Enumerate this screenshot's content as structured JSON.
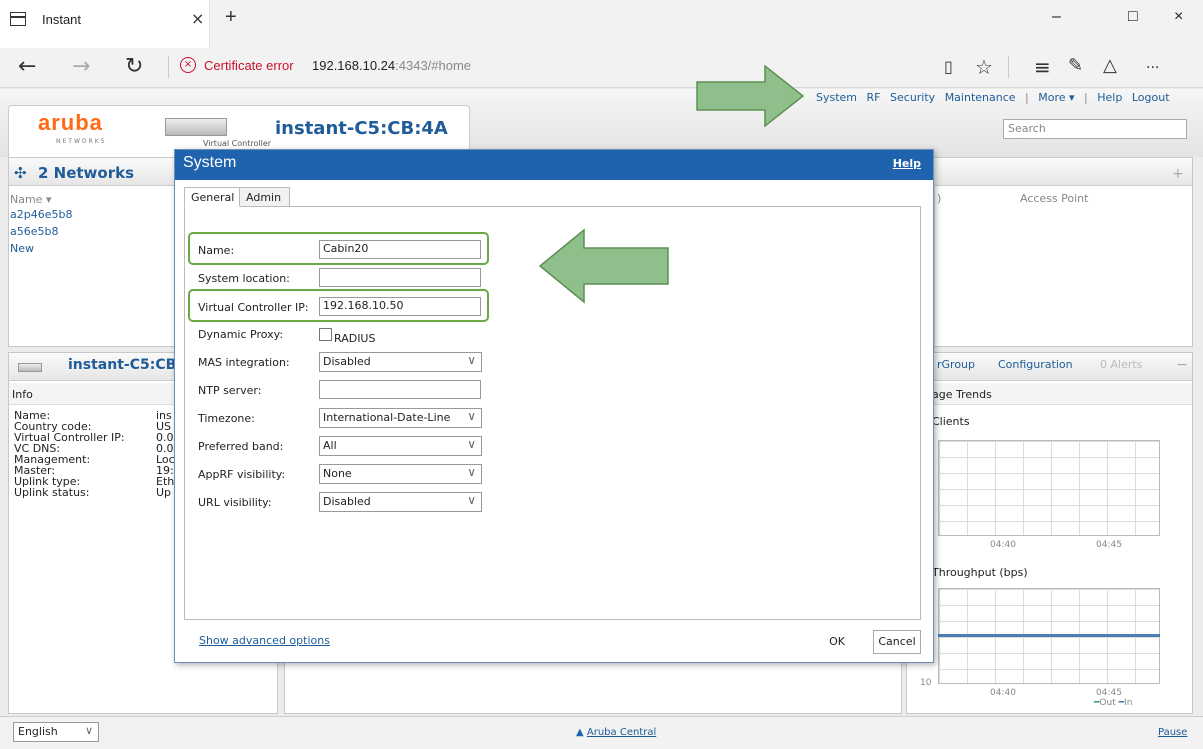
{
  "browser": {
    "tab_title": "Instant",
    "tab_close": "×",
    "new_tab": "+",
    "win_min": "–",
    "win_max": "□",
    "win_close": "×",
    "back": "←",
    "forward": "→",
    "refresh": "↻",
    "cert_error": "Certificate error",
    "url_main": "192.168.10.24",
    "url_rest": ":4343/#home",
    "more": "···"
  },
  "header": {
    "logo": "aruba",
    "logo_sub": "NETWORKS",
    "vc_label": "Virtual Controller",
    "vc_name": "instant-C5:CB:4A",
    "nav": [
      "System",
      "RF",
      "Security",
      "Maintenance",
      "|",
      "More ▾",
      "|",
      "Help",
      "Logout"
    ],
    "search_placeholder": "Search"
  },
  "networks": {
    "title": "2 Networks",
    "col_name": "Name",
    "items": [
      "a2p46e5b8",
      "a56e5b8",
      "New"
    ],
    "plus": "+"
  },
  "ap_panel": {
    "col_access_point": "Access Point"
  },
  "vc_panel": {
    "title": "instant-C5:CB:4A",
    "info_header": "Info",
    "rows": [
      {
        "label": "Name:",
        "value": "ins"
      },
      {
        "label": "Country code:",
        "value": "US"
      },
      {
        "label": "Virtual Controller IP:",
        "value": "0.0"
      },
      {
        "label": "VC DNS:",
        "value": "0.0"
      },
      {
        "label": "Management:",
        "value": "Loc"
      },
      {
        "label": "Master:",
        "value": "19:"
      },
      {
        "label": "Uplink type:",
        "value": "Eth"
      },
      {
        "label": "Uplink status:",
        "value": "Up"
      }
    ]
  },
  "right_panel": {
    "tabs": [
      "rGroup",
      "Configuration",
      "0 Alerts"
    ],
    "minus": "−",
    "trends_title": "age Trends",
    "clients_title": "Clients",
    "throughput_title": "Throughput  (bps)",
    "times": [
      "04:40",
      "04:45"
    ],
    "y_label": "10",
    "legend_out": "Out",
    "legend_in": "In"
  },
  "dialog": {
    "title": "System",
    "help": "Help",
    "tabs": [
      "General",
      "Admin"
    ],
    "fields": {
      "name_label": "Name:",
      "name_value": "Cabin20",
      "location_label": "System location:",
      "location_value": "",
      "vcip_label": "Virtual Controller IP:",
      "vcip_value": "192.168.10.50",
      "proxy_label": "Dynamic Proxy:",
      "proxy_option": "RADIUS",
      "mas_label": "MAS integration:",
      "mas_value": "Disabled",
      "ntp_label": "NTP server:",
      "ntp_value": "",
      "tz_label": "Timezone:",
      "tz_value": "International-Date-Line",
      "band_label": "Preferred band:",
      "band_value": "All",
      "apprf_label": "AppRF visibility:",
      "apprf_value": "None",
      "url_label": "URL visibility:",
      "url_value": "Disabled"
    },
    "advanced_link": "Show advanced options",
    "ok": "OK",
    "cancel": "Cancel"
  },
  "status": {
    "language": "English",
    "central": "Aruba Central",
    "pause": "Pause"
  },
  "colors": {
    "aruba_orange": "#ff6a13",
    "link_blue": "#1f5c99",
    "dialog_header": "#1f62ad",
    "highlight_green": "#6aaa44",
    "arrow_fill": "#8fbf8a"
  }
}
